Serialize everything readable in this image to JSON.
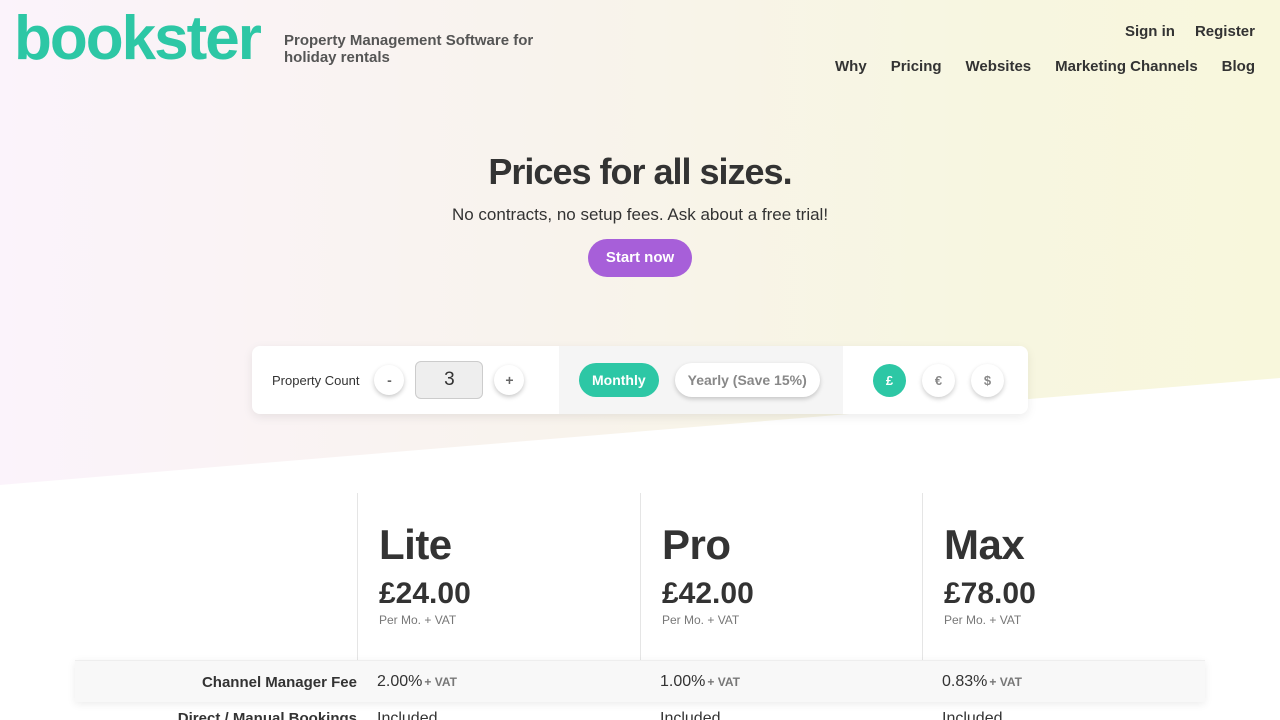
{
  "brand": {
    "logo": "bookster",
    "tagline": "Property Management Software for holiday rentals",
    "color": "#2dc7a5"
  },
  "account": {
    "sign_in": "Sign in",
    "register": "Register"
  },
  "nav": [
    "Why",
    "Pricing",
    "Websites",
    "Marketing Channels",
    "Blog"
  ],
  "hero": {
    "title": "Prices for all sizes.",
    "subtitle": "No contracts, no setup fees. Ask about a free trial!",
    "cta": "Start now"
  },
  "controls": {
    "property_count_label": "Property Count",
    "decrement": "-",
    "increment": "+",
    "property_count": "3",
    "periods": {
      "monthly": "Monthly",
      "yearly": "Yearly (Save 15%)",
      "selected": "Monthly"
    },
    "currencies": {
      "gbp": "£",
      "eur": "€",
      "usd": "$",
      "selected": "£"
    }
  },
  "plans": [
    {
      "name": "Lite",
      "price": "£24.00",
      "per": "Per Mo. + VAT"
    },
    {
      "name": "Pro",
      "price": "£42.00",
      "per": "Per Mo. + VAT"
    },
    {
      "name": "Max",
      "price": "£78.00",
      "per": "Per Mo. + VAT"
    }
  ],
  "features": [
    {
      "name": "Channel Manager Fee",
      "values": [
        "2.00%",
        "1.00%",
        "0.83%"
      ],
      "suffix": "+ VAT"
    },
    {
      "name": "Direct / Manual Bookings",
      "values": [
        "Included",
        "Included",
        "Included"
      ]
    }
  ],
  "colors": {
    "accent": "#2dc7a5",
    "cta": "#a75fd9"
  }
}
